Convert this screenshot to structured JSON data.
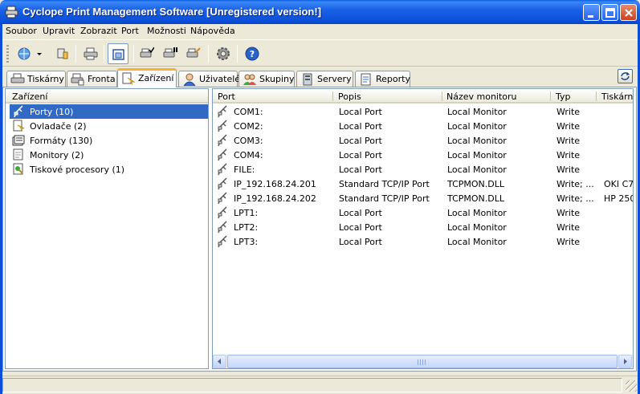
{
  "window": {
    "title": "Cyclope Print Management Software [Unregistered version!]"
  },
  "menu": [
    "Soubor",
    "Upravit",
    "Zobrazit",
    "Port",
    "Možnosti",
    "Nápověda"
  ],
  "tabs": [
    {
      "label": "Tiskárny",
      "icon": "printer-icon"
    },
    {
      "label": "Fronta",
      "icon": "queue-icon"
    },
    {
      "label": "Zařízení",
      "icon": "device-icon",
      "active": true
    },
    {
      "label": "Uživatelé",
      "icon": "user-icon"
    },
    {
      "label": "Skupiny",
      "icon": "group-icon"
    },
    {
      "label": "Servery",
      "icon": "server-icon"
    },
    {
      "label": "Reporty",
      "icon": "report-icon"
    }
  ],
  "left_pane": {
    "header": "Zařízení",
    "items": [
      {
        "label": "Porty (10)",
        "icon": "port-icon",
        "selected": true
      },
      {
        "label": "Ovladače (2)",
        "icon": "driver-icon"
      },
      {
        "label": "Formáty (130)",
        "icon": "format-icon"
      },
      {
        "label": "Monitory (2)",
        "icon": "monitor-icon"
      },
      {
        "label": "Tiskové procesory (1)",
        "icon": "processor-icon"
      }
    ]
  },
  "table": {
    "columns": [
      "Port",
      "Popis",
      "Název monitoru",
      "Typ",
      "Tiskárn"
    ],
    "rows": [
      [
        "COM1:",
        "Local Port",
        "Local Monitor",
        "Write",
        ""
      ],
      [
        "COM2:",
        "Local Port",
        "Local Monitor",
        "Write",
        ""
      ],
      [
        "COM3:",
        "Local Port",
        "Local Monitor",
        "Write",
        ""
      ],
      [
        "COM4:",
        "Local Port",
        "Local Monitor",
        "Write",
        ""
      ],
      [
        "FILE:",
        "Local Port",
        "Local Monitor",
        "Write",
        ""
      ],
      [
        "IP_192.168.24.201",
        "Standard TCP/IP Port",
        "TCPMON.DLL",
        "Write; ...",
        "OKI C7"
      ],
      [
        "IP_192.168.24.202",
        "Standard TCP/IP Port",
        "TCPMON.DLL",
        "Write; ...",
        "HP 250"
      ],
      [
        "LPT1:",
        "Local Port",
        "Local Monitor",
        "Write",
        ""
      ],
      [
        "LPT2:",
        "Local Port",
        "Local Monitor",
        "Write",
        ""
      ],
      [
        "LPT3:",
        "Local Port",
        "Local Monitor",
        "Write",
        ""
      ]
    ]
  },
  "colors": {
    "titlebar": "#0b4fd8",
    "selection": "#316ac5",
    "active_tab_accent": "#f9b034"
  }
}
